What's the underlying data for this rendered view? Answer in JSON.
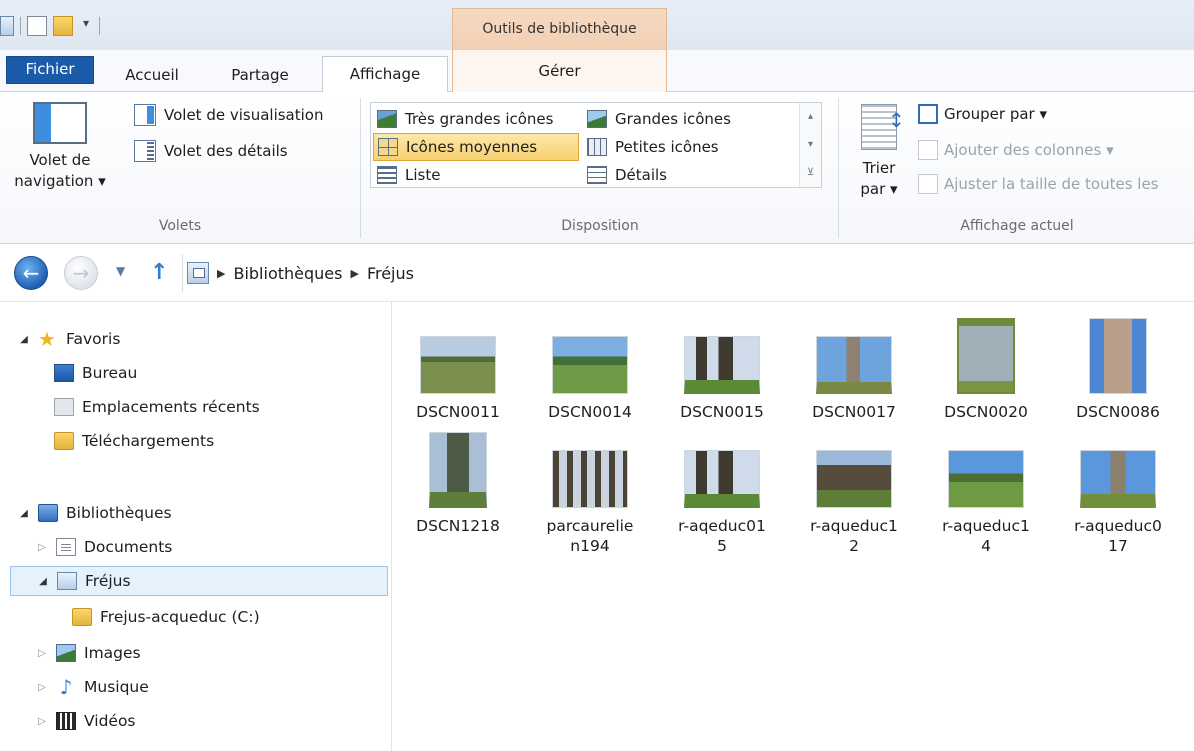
{
  "ribbon": {
    "context_tab_label": "Outils de bibliothèque",
    "tabs": {
      "fichier": "Fichier",
      "accueil": "Accueil",
      "partage": "Partage",
      "affichage": "Affichage",
      "gerer": "Gérer"
    },
    "volets": {
      "nav_pane_label_1": "Volet de",
      "nav_pane_label_2": "navigation ▾",
      "preview_pane": "Volet de visualisation",
      "details_pane": "Volet des détails",
      "group_label": "Volets"
    },
    "disposition": {
      "items": [
        "Très grandes icônes",
        "Grandes icônes",
        "Icônes moyennes",
        "Petites icônes",
        "Liste",
        "Détails"
      ],
      "selected": "Icônes moyennes",
      "group_label": "Disposition"
    },
    "affichage_actuel": {
      "sort_label_1": "Trier",
      "sort_label_2": "par ▾",
      "group_by": "Grouper par ▾",
      "add_columns": "Ajouter des colonnes ▾",
      "size_columns": "Ajuster la taille de toutes les",
      "group_label": "Affichage actuel"
    }
  },
  "address": {
    "crumbs": [
      "Bibliothèques",
      "Fréjus"
    ]
  },
  "nav": {
    "favoris": "Favoris",
    "bureau": "Bureau",
    "recents": "Emplacements récents",
    "telechargements": "Téléchargements",
    "bibliotheques": "Bibliothèques",
    "documents": "Documents",
    "frejus": "Fréjus",
    "frejus_folder": "Frejus-acqueduc (C:)",
    "images": "Images",
    "musique": "Musique",
    "videos": "Vidéos"
  },
  "files": [
    {
      "name": "DSCN0011",
      "thumb": "landscape"
    },
    {
      "name": "DSCN0014",
      "thumb": "landscape"
    },
    {
      "name": "DSCN0015",
      "thumb": "ruin"
    },
    {
      "name": "DSCN0017",
      "thumb": "tower"
    },
    {
      "name": "DSCN0020",
      "thumb": "sign"
    },
    {
      "name": "DSCN0086",
      "thumb": "statue"
    },
    {
      "name": "DSCN1218",
      "thumb": "tree"
    },
    {
      "name": "parcaurelie\nn194",
      "thumb": "trees"
    },
    {
      "name": "r-aqeduc01\n5",
      "thumb": "ruin"
    },
    {
      "name": "r-aqueduc1\n2",
      "thumb": "tower"
    },
    {
      "name": "r-aqueduc1\n4",
      "thumb": "landscape"
    },
    {
      "name": "r-aqueduc0\n17",
      "thumb": "tower"
    }
  ],
  "colors": {
    "accent": "#1a5aa8",
    "context_tab": "#f2cfb3",
    "selection": "#e5f1fb"
  }
}
